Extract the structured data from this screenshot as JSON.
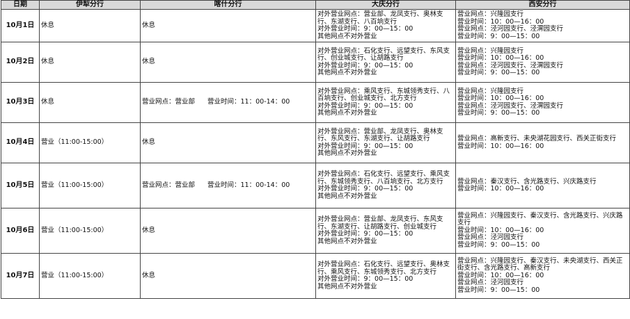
{
  "headers": [
    "日期",
    "伊犁分行",
    "喀什分行",
    "大庆分行",
    "西安分行"
  ],
  "rows": [
    {
      "date": "10月1日",
      "yili": "休息",
      "kashi": "休息",
      "daqing": [
        "对外营业网点：营业部、龙凤支行、奥林支行、东湖支行、八百垧支行",
        "对外营业时间：9：00—15：00",
        "其他网点不对外营业"
      ],
      "xian": [
        "营业网点：兴隆园支行",
        "营业时间：10：00—16：00",
        "营业网点：泾河园支行、泾渭园支行",
        "营业时间：9：00—15：00"
      ]
    },
    {
      "date": "10月2日",
      "yili": "休息",
      "kashi": "休息",
      "daqing": [
        "对外营业网点：石化支行、远望支行、东风支行、创业城支行、让胡路支行",
        "对外营业时间：9：00—15：00",
        "其他网点不对外营业"
      ],
      "xian": [
        "营业网点：兴隆园支行",
        "营业时间：10：00—16：00",
        "营业网点：泾河园支行、泾渭园支行",
        "营业时间：9：00—15：00"
      ]
    },
    {
      "date": "10月3日",
      "yili": "休息",
      "kashi_place": "营业网点：营业部",
      "kashi_time": "营业时间：11：00-14：00",
      "daqing": [
        "对外营业网点：乘风支行、东城领秀支行、八百垧支行、创业城支行、北方支行",
        "对外营业时间：9：00—15：00",
        "其他网点不对外营业"
      ],
      "xian": [
        "营业网点：兴隆园支行",
        "营业时间：10：00—16：00",
        "营业网点：泾河园支行、泾渭园支行",
        "营业时间：9：00—15：00"
      ]
    },
    {
      "date": "10月4日",
      "yili": "营业（11:00-15:00）",
      "kashi": "休息",
      "daqing": [
        "对外营业网点：营业部、龙凤支行、奥林支行、东风支行、东湖支行、让胡路支行",
        "对外营业时间：9：00—15：00",
        "其他网点不对外营业"
      ],
      "xian": [
        "营业网点：高新支行、未央湖花园支行、西关正街支行",
        "营业时间：10：00—16：00"
      ]
    },
    {
      "date": "10月5日",
      "yili": "营业（11:00-15:00）",
      "kashi_place": "营业网点：营业部",
      "kashi_time": "营业时间：11：00-14：00",
      "daqing": [
        "对外营业网点：石化支行、远望支行、乘风支行、东城领秀支行、八百垧支行、北方支行",
        "对外营业时间：9：00—15：00",
        "其他网点不对外营业"
      ],
      "xian": [
        "营业网点：秦汉支行、含光路支行、兴庆路支行",
        "营业时间：10：00—16：00"
      ]
    },
    {
      "date": "10月6日",
      "yili": "营业（11:00-15:00）",
      "kashi": "休息",
      "daqing": [
        "对外营业网点：营业部、龙凤支行、东风支行、东湖支行、让胡路支行、创业城支行",
        "对外营业时间：9：00—15：00",
        "其他网点不对外营业"
      ],
      "xian": [
        "营业网点：兴隆园支行、秦汉支行、含光路支行、兴庆路支行",
        "营业时间：10：00—16：00",
        "营业网点：泾河园支行",
        "营业时间：9：00—15：00"
      ]
    },
    {
      "date": "10月7日",
      "yili": "营业（11:00-15:00）",
      "kashi": "休息",
      "daqing": [
        "对外营业网点：石化支行、远望支行、奥林支行、乘风支行、东城领秀支行、北方支行",
        "对外营业时间：9：00—15：00",
        "其他网点不对外营业"
      ],
      "xian": [
        "营业网点：兴隆园支行、秦汉支行、未央湖支行、西关正街支行、含光路支行、高新支行",
        "营业时间：10：00—16：00",
        "营业网点：泾河园支行",
        "营业时间：9：00—15：00"
      ]
    }
  ]
}
